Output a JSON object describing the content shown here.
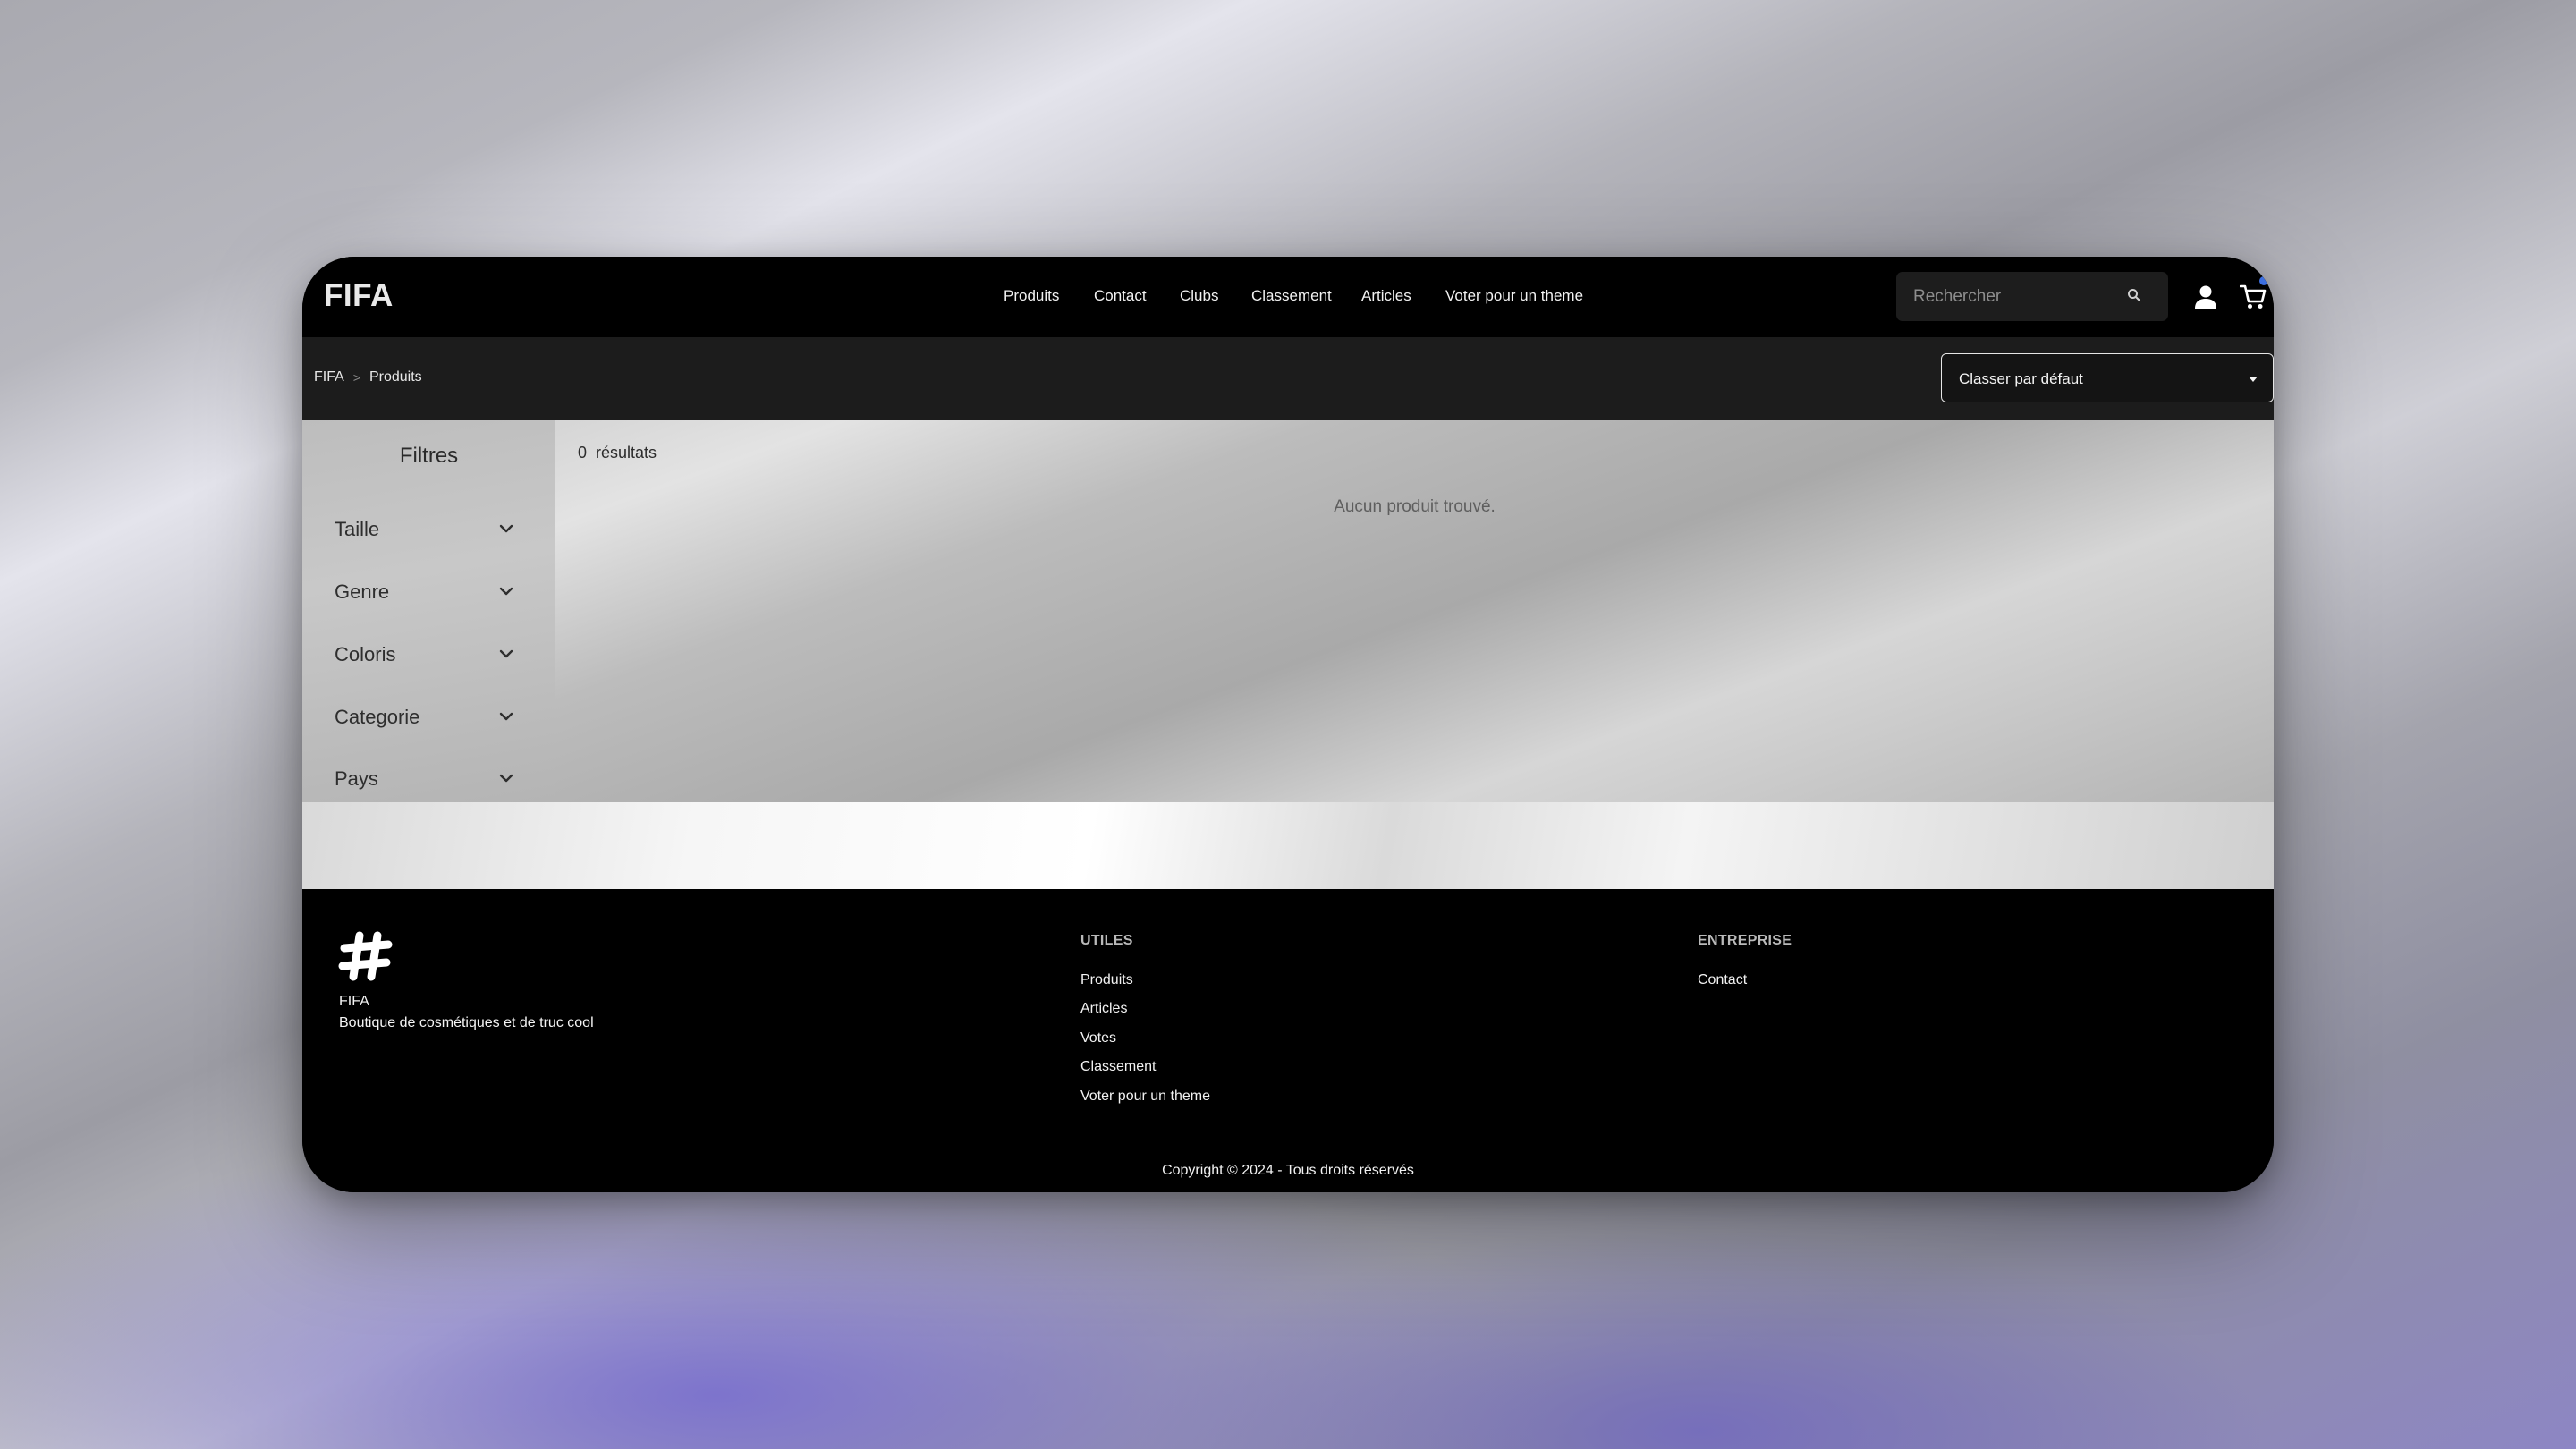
{
  "header": {
    "logo": "FIFA",
    "nav": [
      "Produits",
      "Contact",
      "Clubs",
      "Classement",
      "Articles",
      "Voter pour un theme"
    ],
    "search_placeholder": "Rechercher",
    "icons": [
      "search-icon",
      "user-icon",
      "cart-icon"
    ]
  },
  "breadcrumb": {
    "home": "FIFA",
    "current": "Produits"
  },
  "sort": {
    "selected": "Classer par défaut"
  },
  "filters": {
    "title": "Filtres",
    "items": [
      "Taille",
      "Genre",
      "Coloris",
      "Categorie",
      "Pays"
    ]
  },
  "results": {
    "count": "0",
    "label": "résultats",
    "empty_message": "Aucun produit trouvé."
  },
  "footer": {
    "brand_name": "FIFA",
    "tagline": "Boutique de cosmétiques et de truc cool",
    "useful_title": "UTILES",
    "useful_links": [
      "Produits",
      "Articles",
      "Votes",
      "Classement",
      "Voter pour un theme"
    ],
    "company_title": "ENTREPRISE",
    "company_links": [
      "Contact"
    ],
    "copyright": "Copyright © 2024 - Tous droits réservés"
  },
  "colors": {
    "accent_badge": "#3d6fe0",
    "header_bg": "#000000",
    "crumbbar_bg": "#1c1c1c"
  }
}
